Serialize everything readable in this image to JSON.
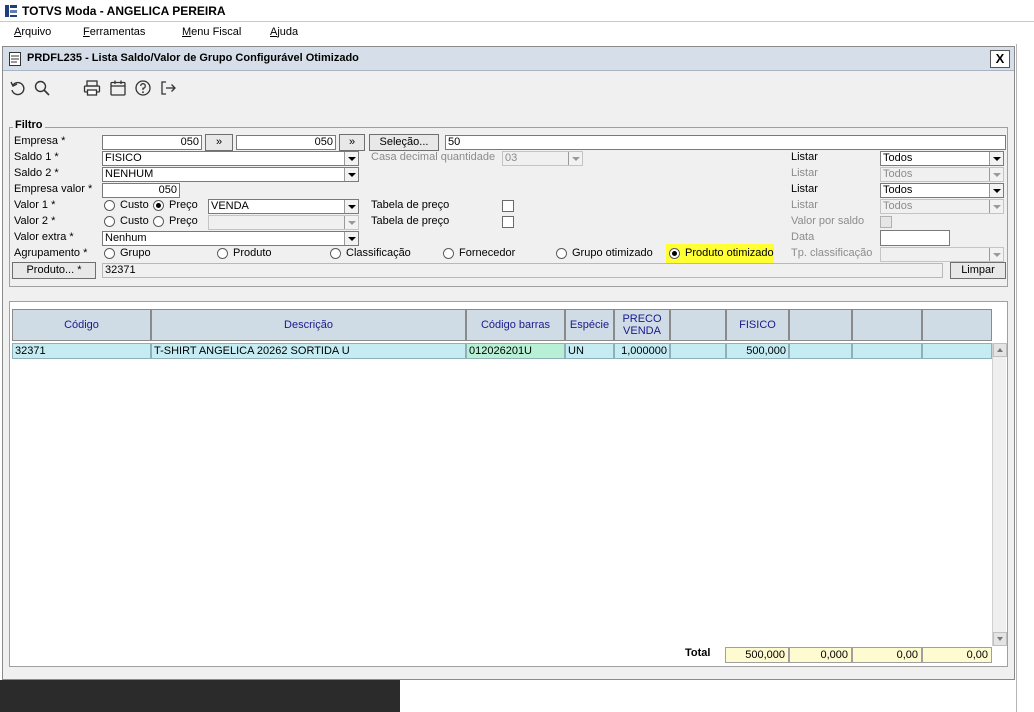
{
  "app": {
    "title": "TOTVS Moda - ANGELICA PEREIRA"
  },
  "menu": [
    {
      "label": "Arquivo",
      "accel": "A"
    },
    {
      "label": "Ferramentas",
      "accel": "F"
    },
    {
      "label": "Menu Fiscal",
      "accel": "M"
    },
    {
      "label": "Ajuda",
      "accel": "A"
    }
  ],
  "dialog": {
    "title": "PRDFL235 - Lista Saldo/Valor de Grupo Configurável Otimizado",
    "close": "X"
  },
  "toolbar": [
    "undo-icon",
    "search-icon",
    "print-icon",
    "calendar-icon",
    "help-icon",
    "exit-icon"
  ],
  "filter": {
    "legend": "Filtro",
    "empresa": {
      "label": "Empresa *",
      "from": "050",
      "to": "050",
      "jump": "»"
    },
    "selecao": {
      "label": "Seleção...",
      "value": "50"
    },
    "saldo1": {
      "label": "Saldo 1 *",
      "value": "FISICO"
    },
    "casa_decimal": {
      "label": "Casa decimal quantidade",
      "value": "03"
    },
    "saldo2": {
      "label": "Saldo 2 *",
      "value": "NENHUM"
    },
    "empresa_valor": {
      "label": "Empresa valor *",
      "value": "050"
    },
    "valor1": {
      "label": "Valor 1 *",
      "custo": "Custo",
      "preco": "Preço",
      "value": "VENDA"
    },
    "valor2": {
      "label": "Valor 2 *",
      "custo": "Custo",
      "preco": "Preço",
      "value": ""
    },
    "tabela_preco1": "Tabela de preço",
    "tabela_preco2": "Tabela de preço",
    "valor_extra": {
      "label": "Valor extra *",
      "value": "Nenhum"
    },
    "listar": [
      {
        "label": "Listar",
        "value": "Todos",
        "enabled": true
      },
      {
        "label": "Listar",
        "value": "Todos",
        "enabled": false
      },
      {
        "label": "Listar",
        "value": "Todos",
        "enabled": true
      },
      {
        "label": "Listar",
        "value": "Todos",
        "enabled": false
      }
    ],
    "valor_por_saldo": "Valor por saldo",
    "data": "Data",
    "agrupamento": {
      "label": "Agrupamento *",
      "options": [
        "Grupo",
        "Produto",
        "Classificação",
        "Fornecedor",
        "Grupo otimizado",
        "Produto otimizado"
      ],
      "selected": "Produto otimizado"
    },
    "tp_classificacao": "Tp. classificação",
    "produto": {
      "label": "Produto... *",
      "value": "32371"
    },
    "limpar": "Limpar"
  },
  "grid": {
    "headers": [
      "Código",
      "Descrição",
      "Código barras",
      "Espécie",
      "PRECO VENDA",
      "",
      "FISICO",
      "",
      "",
      ""
    ],
    "rows": [
      [
        "32371",
        "T-SHIRT ANGELICA 20262 SORTIDA U",
        "012026201U",
        "UN",
        "1,000000",
        "",
        "500,000",
        "",
        "",
        ""
      ]
    ],
    "total_label": "Total",
    "totals": [
      "500,000",
      "0,000",
      "0,00",
      "0,00"
    ]
  }
}
